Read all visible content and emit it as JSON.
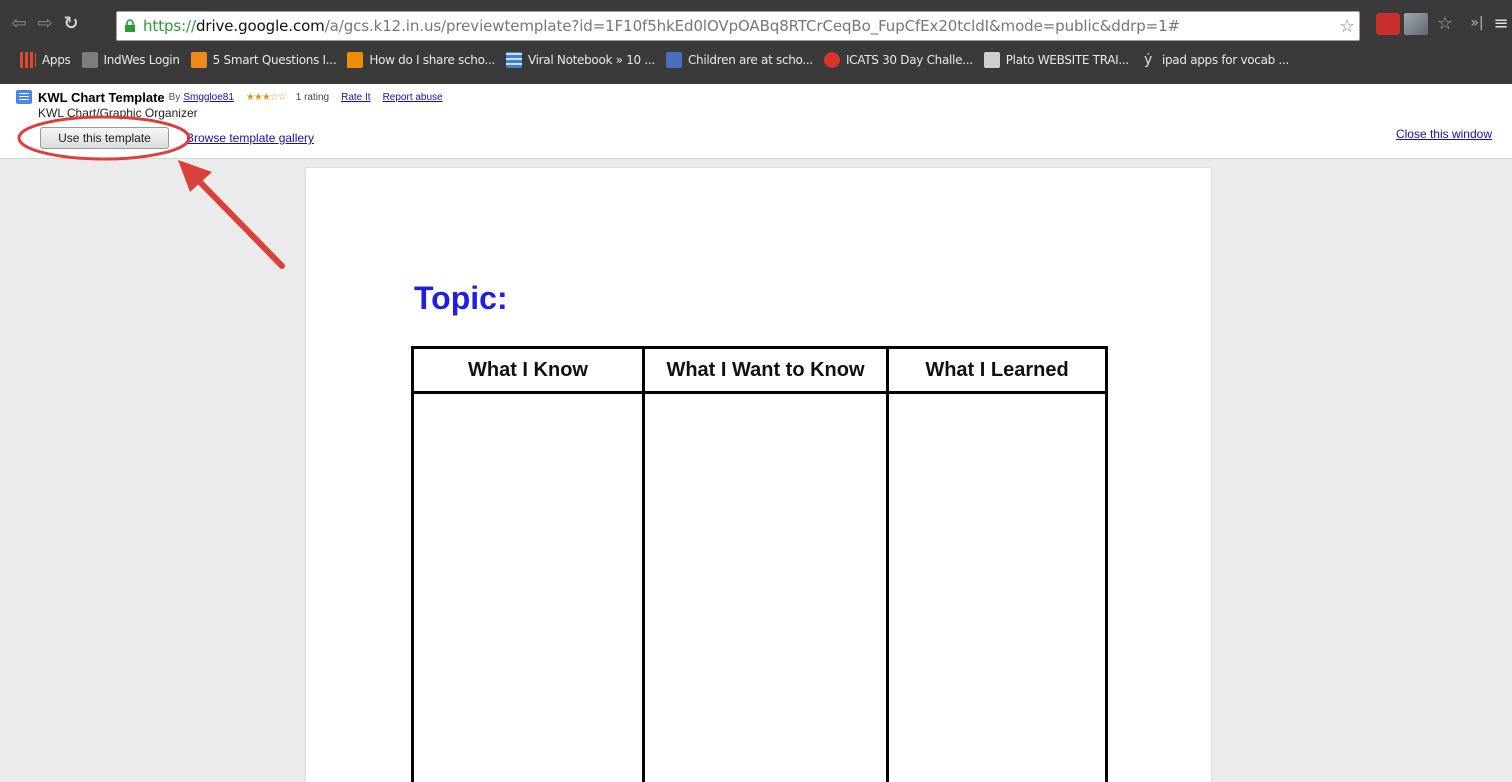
{
  "browser": {
    "url": {
      "scheme": "https://",
      "host": "drive.google.com",
      "path": "/a/gcs.k12.in.us/previewtemplate?id=1F10f5hkEd0lOVpOABq8RTCrCeqBo_FupCfEx20tcldI&mode=public&ddrp=1#"
    },
    "nav_icons": [
      "back-icon",
      "forward-icon",
      "reload-icon"
    ],
    "bookmarks": [
      {
        "label": "Apps",
        "icon": "apps-grid-icon",
        "color": "#e04b2c"
      },
      {
        "label": "IndWes Login",
        "icon": "indwes-icon",
        "color": "#7d7d7d"
      },
      {
        "label": "5 Smart Questions I...",
        "icon": "bookmark-orange-icon",
        "color": "#ef8a1a"
      },
      {
        "label": "How do I share scho...",
        "icon": "chat-icon",
        "color": "#f28c00"
      },
      {
        "label": "Viral Notebook » 10 ...",
        "icon": "grid-icon",
        "color": "#3f7fd6"
      },
      {
        "label": "Children are at scho...",
        "icon": "g-icon",
        "color": "#4a6fb8"
      },
      {
        "label": "ICATS 30 Day Challe...",
        "icon": "icats-icon",
        "color": "#d9332b"
      },
      {
        "label": "Plato WEBSITE TRAI...",
        "icon": "folder-icon",
        "color": "#cfcfcf"
      },
      {
        "label": "ipad apps for vocab ...",
        "icon": "runner-icon",
        "color": "#dddddd"
      }
    ]
  },
  "template": {
    "title": "KWL Chart Template",
    "by_label": "By",
    "author": "Smggloe81",
    "stars": "★★★☆☆",
    "rating": "1 rating",
    "rate_it": "Rate It",
    "report_abuse": "Report abuse",
    "subtitle": "KWL Chart/Graphic Organizer",
    "use_button": "Use this template",
    "browse_link": "Browse template gallery",
    "close_link": "Close this window"
  },
  "document": {
    "topic": "Topic:",
    "columns": [
      "What I Know",
      "What I Want to Know",
      "What I Learned"
    ]
  },
  "colors": {
    "topic": "#1f1fe0",
    "annotation": "#d9413a",
    "link": "#1a0dab"
  }
}
